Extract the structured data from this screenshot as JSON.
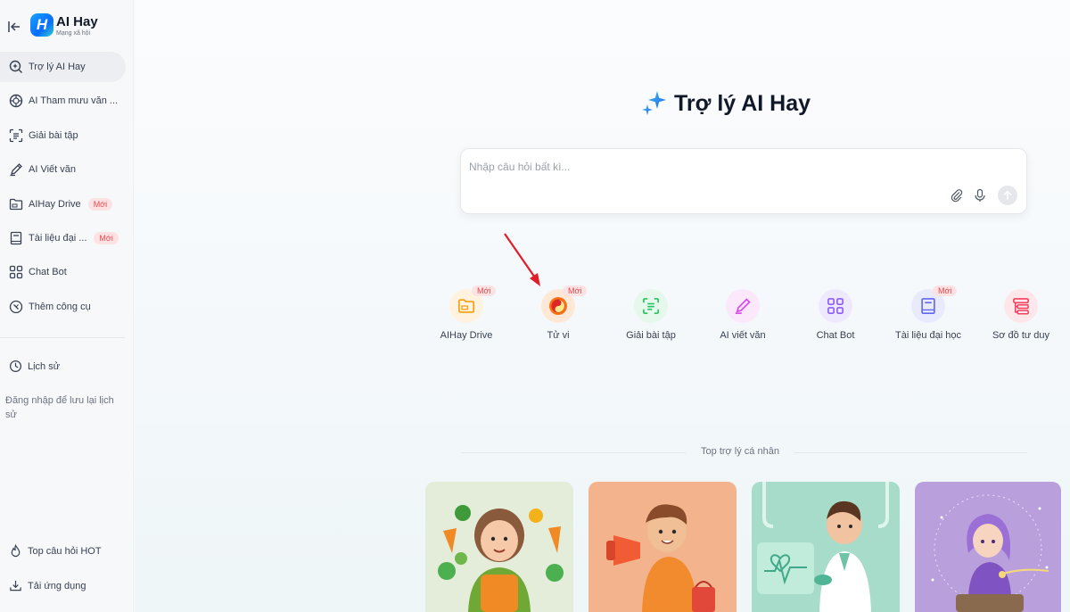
{
  "brand": {
    "logo_letter": "H",
    "name": "AI Hay",
    "tagline": "Mạng xã hội"
  },
  "sidebar": {
    "items": [
      {
        "label": "Trợ lý AI Hay",
        "icon": "ai-search-icon",
        "active": true
      },
      {
        "label": "AI Tham mưu văn ...",
        "icon": "emblem-icon"
      },
      {
        "label": "Giải bài tập",
        "icon": "scan-text-icon"
      },
      {
        "label": "AI Viết văn",
        "icon": "pen-icon"
      },
      {
        "label": "AIHay Drive",
        "icon": "folder-icon",
        "badge": "Mới"
      },
      {
        "label": "Tài liệu đại ...",
        "icon": "book-icon",
        "badge": "Mới"
      },
      {
        "label": "Chat Bot",
        "icon": "grid-icon"
      },
      {
        "label": "Thêm công cụ",
        "icon": "compass-icon"
      }
    ],
    "history_label": "Lịch sử",
    "login_hint": "Đăng nhập để lưu lại lịch sử",
    "hot_label": "Top câu hỏi HOT",
    "download_label": "Tải ứng dụng"
  },
  "main": {
    "title": "Trợ lý AI Hay",
    "search": {
      "placeholder": "Nhập câu hỏi bất kì..."
    },
    "tools": [
      {
        "label": "AIHay Drive",
        "icon": "folder-icon",
        "badge": "Mới",
        "color": "#f59e0b"
      },
      {
        "label": "Tử vi",
        "icon": "horoscope-icon",
        "badge": "Mới",
        "color": "#ea580c"
      },
      {
        "label": "Giải bài tập",
        "icon": "scan-text-icon",
        "color": "#22c55e"
      },
      {
        "label": "AI viết văn",
        "icon": "pen-icon",
        "color": "#d946ef"
      },
      {
        "label": "Chat Bot",
        "icon": "grid-icon",
        "color": "#8b5cf6"
      },
      {
        "label": "Tài liệu đại học",
        "icon": "book-icon",
        "badge": "Mới",
        "color": "#6366f1"
      },
      {
        "label": "Sơ đồ tư duy",
        "icon": "mindmap-icon",
        "color": "#f43f5e"
      }
    ],
    "section_title": "Top trợ lý cá nhân",
    "cards": [
      {
        "name": "nutrition-assistant-card",
        "bg": "#e3edd9"
      },
      {
        "name": "marketing-assistant-card",
        "bg": "#f3b48d"
      },
      {
        "name": "health-assistant-card",
        "bg": "#a6dcc9"
      },
      {
        "name": "astrology-assistant-card",
        "bg": "#b9a0dc"
      }
    ]
  },
  "colors": {
    "badge_bg": "#fde2e4",
    "badge_text": "#e5484d",
    "annotation_arrow": "#e11d2a"
  }
}
